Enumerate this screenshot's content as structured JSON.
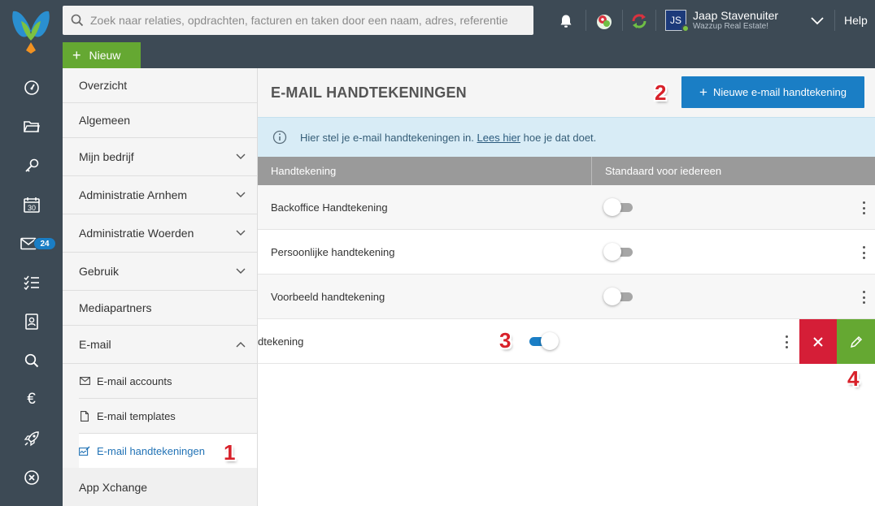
{
  "topbar": {
    "search_placeholder": "Zoek naar relaties, opdrachten, facturen en taken door een naam, adres, referentie",
    "user_initials": "JS",
    "user_name": "Jaap Stavenuiter",
    "user_company": "Wazzup Real Estate!",
    "help_label": "Help",
    "new_label": "Nieuw"
  },
  "rail": {
    "items": [
      {
        "icon": "dashboard-icon"
      },
      {
        "icon": "folder-icon"
      },
      {
        "icon": "key-icon"
      },
      {
        "icon": "calendar-icon",
        "calendar_day": "30"
      },
      {
        "icon": "mail-icon",
        "badge": "24"
      },
      {
        "icon": "checklist-icon"
      },
      {
        "icon": "contacts-icon"
      },
      {
        "icon": "search-icon"
      },
      {
        "icon": "euro-icon",
        "glyph": "€"
      },
      {
        "icon": "rocket-icon"
      },
      {
        "icon": "close-circle-icon"
      }
    ]
  },
  "menu": {
    "items": [
      {
        "label": "Overzicht"
      },
      {
        "label": "Algemeen"
      },
      {
        "label": "Mijn bedrijf"
      },
      {
        "label": "Administratie Arnhem"
      },
      {
        "label": "Administratie Woerden"
      },
      {
        "label": "Gebruik"
      },
      {
        "label": "Mediapartners"
      },
      {
        "label": "E-mail"
      },
      {
        "label": "App Xchange"
      }
    ],
    "email_sub": [
      {
        "label": "E-mail accounts"
      },
      {
        "label": "E-mail templates"
      },
      {
        "label": "E-mail handtekeningen"
      }
    ]
  },
  "main": {
    "title": "E-MAIL HANDTEKENINGEN",
    "new_button_label": "Nieuwe e-mail handtekening",
    "info_prefix": "Hier stel je e-mail handtekeningen in.",
    "info_link": "Lees hier",
    "info_suffix": "hoe je dat doet.",
    "columns": [
      "Handtekening",
      "Standaard voor iedereen"
    ],
    "rows": [
      {
        "name": "Backoffice Handtekening",
        "default": false
      },
      {
        "name": "Persoonlijke handtekening",
        "default": false
      },
      {
        "name": "Voorbeeld handtekening",
        "default": false
      },
      {
        "name": "dtekening",
        "default": true
      }
    ]
  },
  "annotations": [
    "1",
    "2",
    "3",
    "4"
  ],
  "colors": {
    "accent_blue": "#1a7ec5",
    "green": "#65a832",
    "red": "#d51e37",
    "topbar": "#3d4a55",
    "annotation_red": "#d8212a"
  }
}
